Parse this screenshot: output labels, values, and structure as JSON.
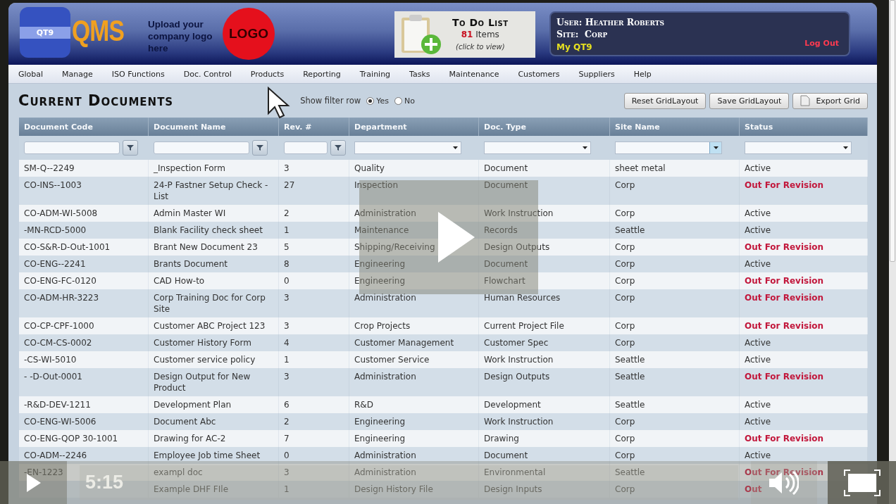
{
  "header": {
    "logo_text": "QT9",
    "brand": "QMS",
    "upload_note": "Upload your company logo here",
    "logo_placeholder": "LOGO",
    "todo": {
      "title": "To Do List",
      "count": "81",
      "count_label": "Items",
      "hint": "(click to view)"
    },
    "user": {
      "user_line": "User: Heather Roberts",
      "site_line": "Site:  Corp",
      "my_link": "My QT9",
      "logout": "Log Out"
    }
  },
  "menu": [
    "Global",
    "Manage",
    "ISO Functions",
    "Doc. Control",
    "Products",
    "Reporting",
    "Training",
    "Tasks",
    "Maintenance",
    "Customers",
    "Suppliers",
    "Help"
  ],
  "page": {
    "title": "Current Documents",
    "filter_row": {
      "label": "Show filter row",
      "options": [
        {
          "label": "Yes",
          "selected": true
        },
        {
          "label": "No",
          "selected": false
        }
      ]
    },
    "buttons": [
      {
        "label": "Reset GridLayout",
        "kind": "plain"
      },
      {
        "label": "Save GridLayout",
        "kind": "plain"
      },
      {
        "label": "Export Grid",
        "kind": "export"
      }
    ]
  },
  "table": {
    "columns": [
      {
        "label": "Document Code",
        "filter": {
          "kind": "text",
          "highlighted": false
        }
      },
      {
        "label": "Document Name",
        "filter": {
          "kind": "text",
          "highlighted": false
        }
      },
      {
        "label": "Rev. #",
        "filter": {
          "kind": "text",
          "highlighted": false
        }
      },
      {
        "label": "Department",
        "filter": {
          "kind": "select",
          "highlighted": false
        }
      },
      {
        "label": "Doc. Type",
        "filter": {
          "kind": "select",
          "highlighted": false
        }
      },
      {
        "label": "Site Name",
        "filter": {
          "kind": "select",
          "highlighted": true
        }
      },
      {
        "label": "Status",
        "filter": {
          "kind": "select",
          "highlighted": false
        }
      }
    ],
    "rows": [
      {
        "cells": [
          "SM-Q--2249",
          "_Inspection Form",
          "3",
          "Quality",
          "Document",
          "sheet metal"
        ],
        "status": {
          "text": "Active",
          "kind": "active"
        }
      },
      {
        "cells": [
          "CO-INS--1003",
          "24-P Fastner Setup Check - List",
          "27",
          "Inspection",
          "Document",
          "Corp"
        ],
        "status": {
          "text": "Out For Revision",
          "kind": "revision"
        }
      },
      {
        "cells": [
          "CO-ADM-WI-5008",
          "Admin Master WI",
          "2",
          "Administration",
          "Work Instruction",
          "Corp"
        ],
        "status": {
          "text": "Active",
          "kind": "active"
        }
      },
      {
        "cells": [
          "-MN-RCD-5000",
          "Blank Facility check sheet",
          "1",
          "Maintenance",
          "Records",
          "Seattle"
        ],
        "status": {
          "text": "Active",
          "kind": "active"
        }
      },
      {
        "cells": [
          "CO-S&R-D-Out-1001",
          "Brant New Document 23",
          "5",
          "Shipping/Receiving",
          "Design Outputs",
          "Corp"
        ],
        "status": {
          "text": "Out For Revision",
          "kind": "revision"
        }
      },
      {
        "cells": [
          "CO-ENG--2241",
          "Brants Document",
          "8",
          "Engineering",
          "Document",
          "Corp"
        ],
        "status": {
          "text": "Active",
          "kind": "active"
        }
      },
      {
        "cells": [
          "CO-ENG-FC-0120",
          "CAD How-to",
          "0",
          "Engineering",
          "Flowchart",
          "Corp"
        ],
        "status": {
          "text": "Out For Revision",
          "kind": "revision"
        }
      },
      {
        "cells": [
          "CO-ADM-HR-3223",
          "Corp Training Doc for Corp Site",
          "3",
          "Administration",
          "Human Resources",
          "Corp"
        ],
        "status": {
          "text": "Out For Revision",
          "kind": "revision"
        }
      },
      {
        "cells": [
          "CO-CP-CPF-1000",
          "Customer ABC Project 123",
          "3",
          "Crop Projects",
          "Current Project File",
          "Corp"
        ],
        "status": {
          "text": "Out For Revision",
          "kind": "revision"
        }
      },
      {
        "cells": [
          "CO-CM-CS-0002",
          "Customer History Form",
          "4",
          "Customer Management",
          "Customer Spec",
          "Corp"
        ],
        "status": {
          "text": "Active",
          "kind": "active"
        }
      },
      {
        "cells": [
          "-CS-WI-5010",
          "Customer service policy",
          "1",
          "Customer Service",
          "Work Instruction",
          "Seattle"
        ],
        "status": {
          "text": "Active",
          "kind": "active"
        }
      },
      {
        "cells": [
          "- -D-Out-0001",
          "Design Output for New Product",
          "3",
          "Administration",
          "Design Outputs",
          "Seattle"
        ],
        "status": {
          "text": "Out For Revision",
          "kind": "revision"
        }
      },
      {
        "cells": [
          "-R&D-DEV-1211",
          "Development Plan",
          "6",
          "R&D",
          "Development",
          "Seattle"
        ],
        "status": {
          "text": "Active",
          "kind": "active"
        }
      },
      {
        "cells": [
          "CO-ENG-WI-5006",
          "Document Abc",
          "2",
          "Engineering",
          "Work Instruction",
          "Corp"
        ],
        "status": {
          "text": "Active",
          "kind": "active"
        }
      },
      {
        "cells": [
          "CO-ENG-QOP 30-1001",
          "Drawing for AC-2",
          "7",
          "Engineering",
          "Drawing",
          "Corp"
        ],
        "status": {
          "text": "Out For Revision",
          "kind": "revision"
        }
      },
      {
        "cells": [
          "CO-ADM--2246",
          "Employee Job time Sheet",
          "0",
          "Administration",
          "Document",
          "Corp"
        ],
        "status": {
          "text": "Active",
          "kind": "active"
        }
      },
      {
        "cells": [
          "-EN-1223",
          "exampl doc",
          "3",
          "Administration",
          "Environmental",
          "Seattle"
        ],
        "status": {
          "text": "Out For Revision",
          "kind": "revision"
        }
      },
      {
        "cells": [
          "",
          "Example DHF FIle",
          "1",
          "Design History File",
          "Design Inputs",
          "Corp"
        ],
        "status": {
          "text": "Out",
          "kind": "revision"
        }
      }
    ]
  },
  "video": {
    "time": "5:15"
  }
}
